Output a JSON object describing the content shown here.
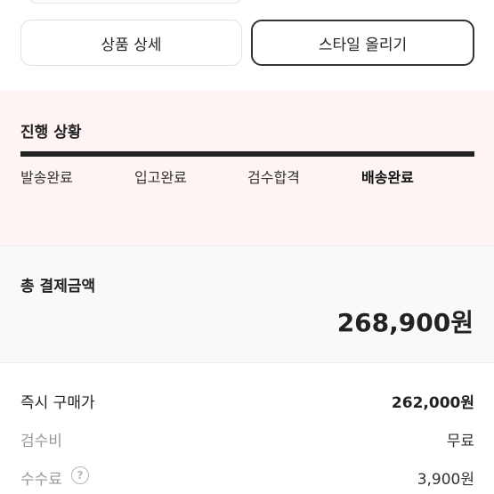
{
  "buttons": {
    "product_detail": "상품 상세",
    "upload_style": "스타일 올리기"
  },
  "progress": {
    "title": "진행 상황",
    "steps": [
      "발송완료",
      "입고완료",
      "검수합격",
      "배송완료"
    ],
    "current_step": "배송완료"
  },
  "total": {
    "label": "총 결제금액",
    "amount": "268,900원"
  },
  "breakdown": {
    "instant_price": {
      "label": "즉시 구매가",
      "value": "262,000원"
    },
    "inspection_fee": {
      "label": "검수비",
      "value": "무료"
    },
    "commission": {
      "label": "수수료",
      "value": "3,900원",
      "help_icon": "?"
    }
  },
  "colors": {
    "progress_bg": "#fdf4f3",
    "total_bg": "#f9f9f9",
    "accent": "#222222"
  },
  "icons": {
    "help": "question-circle-icon"
  }
}
